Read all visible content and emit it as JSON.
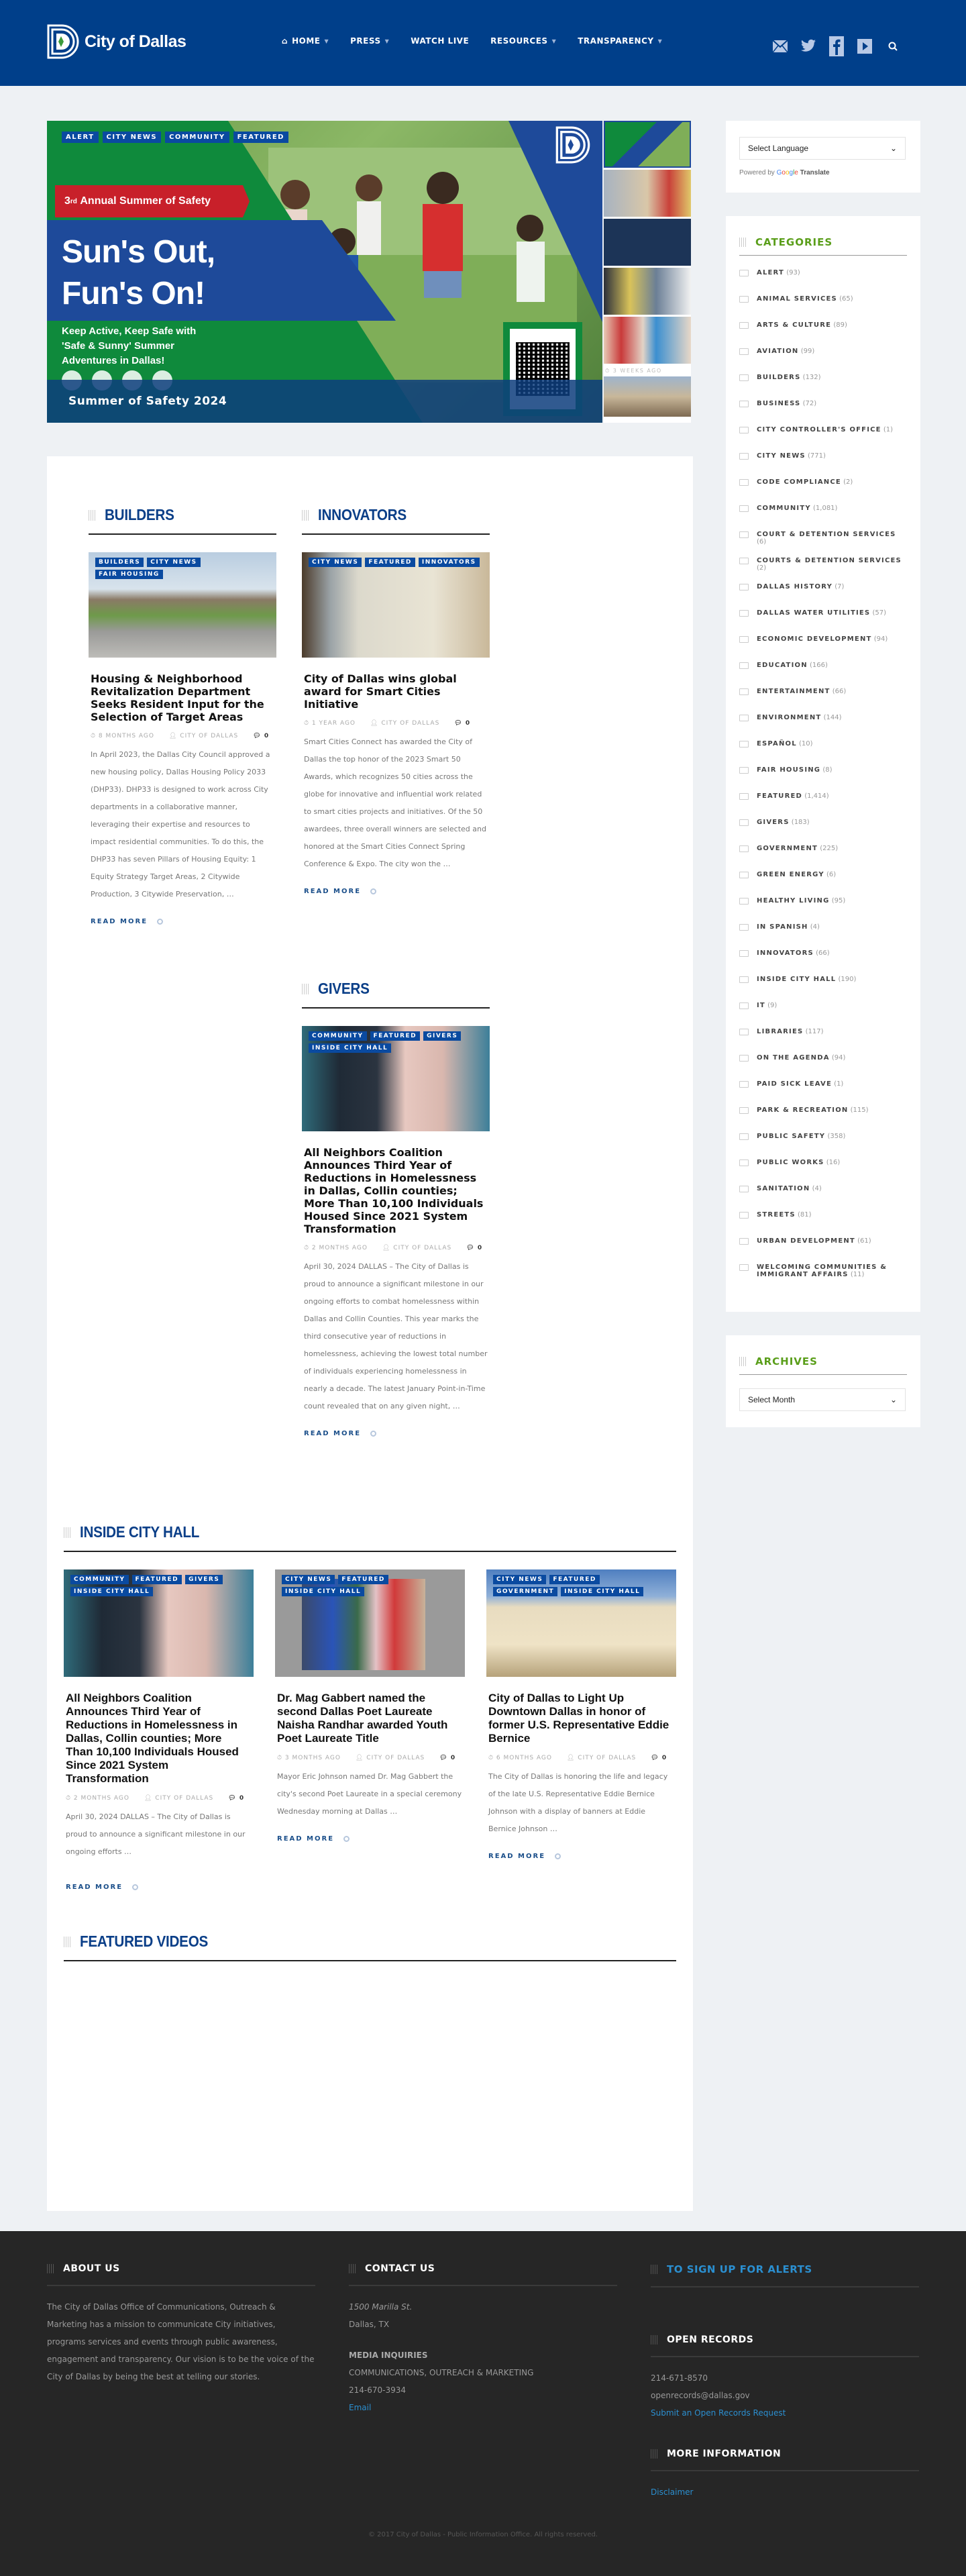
{
  "header": {
    "site_name": "City of Dallas",
    "nav": [
      {
        "label": "HOME",
        "icon": "home-icon",
        "has_dropdown": true
      },
      {
        "label": "PRESS",
        "has_dropdown": true
      },
      {
        "label": "WATCH LIVE",
        "has_dropdown": false
      },
      {
        "label": "RESOURCES",
        "has_dropdown": true
      },
      {
        "label": "TRANSPARENCY",
        "has_dropdown": true
      }
    ],
    "social": [
      "email-icon",
      "twitter-icon",
      "facebook-icon",
      "youtube-icon",
      "search-icon"
    ],
    "brand_color": "#003f8a"
  },
  "hero": {
    "tags": [
      "ALERT",
      "CITY NEWS",
      "COMMUNITY",
      "FEATURED"
    ],
    "banner_num": "3",
    "banner_sup": "rd",
    "banner_text": "Annual Summer of Safety",
    "headline_1": "Sun's Out,",
    "headline_2": "Fun's On!",
    "subtext": "Keep Active, Keep Safe with 'Safe & Sunny' Summer Adventures in Dallas!",
    "caption": "Summer of Safety 2024",
    "thumbs_meta": "3 WEEKS AGO"
  },
  "translate": {
    "select_label": "Select Language",
    "powered_by": "Powered by",
    "translate_label": "Translate"
  },
  "categories": {
    "title": "CATEGORIES",
    "items": [
      {
        "label": "ALERT",
        "count": "(93)"
      },
      {
        "label": "ANIMAL SERVICES",
        "count": "(65)"
      },
      {
        "label": "ARTS & CULTURE",
        "count": "(89)"
      },
      {
        "label": "AVIATION",
        "count": "(99)"
      },
      {
        "label": "BUILDERS",
        "count": "(132)"
      },
      {
        "label": "BUSINESS",
        "count": "(72)"
      },
      {
        "label": "CITY CONTROLLER'S OFFICE",
        "count": "(1)"
      },
      {
        "label": "CITY NEWS",
        "count": "(771)"
      },
      {
        "label": "CODE COMPLIANCE",
        "count": "(2)"
      },
      {
        "label": "COMMUNITY",
        "count": "(1,081)"
      },
      {
        "label": "COURT & DETENTION SERVICES",
        "count": "(6)"
      },
      {
        "label": "COURTS & DETENTION SERVICES",
        "count": "(2)"
      },
      {
        "label": "DALLAS HISTORY",
        "count": "(7)"
      },
      {
        "label": "DALLAS WATER UTILITIES",
        "count": "(57)"
      },
      {
        "label": "ECONOMIC DEVELOPMENT",
        "count": "(94)"
      },
      {
        "label": "EDUCATION",
        "count": "(166)"
      },
      {
        "label": "ENTERTAINMENT",
        "count": "(66)"
      },
      {
        "label": "ENVIRONMENT",
        "count": "(144)"
      },
      {
        "label": "ESPAÑOL",
        "count": "(10)"
      },
      {
        "label": "FAIR HOUSING",
        "count": "(8)"
      },
      {
        "label": "FEATURED",
        "count": "(1,414)"
      },
      {
        "label": "GIVERS",
        "count": "(183)"
      },
      {
        "label": "GOVERNMENT",
        "count": "(225)"
      },
      {
        "label": "GREEN ENERGY",
        "count": "(6)"
      },
      {
        "label": "HEALTHY LIVING",
        "count": "(95)"
      },
      {
        "label": "IN SPANISH",
        "count": "(4)"
      },
      {
        "label": "INNOVATORS",
        "count": "(66)"
      },
      {
        "label": "INSIDE CITY HALL",
        "count": "(190)"
      },
      {
        "label": "IT",
        "count": "(9)"
      },
      {
        "label": "LIBRARIES",
        "count": "(117)"
      },
      {
        "label": "ON THE AGENDA",
        "count": "(94)"
      },
      {
        "label": "PAID SICK LEAVE",
        "count": "(1)"
      },
      {
        "label": "PARK & RECREATION",
        "count": "(115)"
      },
      {
        "label": "PUBLIC SAFETY",
        "count": "(358)"
      },
      {
        "label": "PUBLIC WORKS",
        "count": "(16)"
      },
      {
        "label": "SANITATION",
        "count": "(4)"
      },
      {
        "label": "STREETS",
        "count": "(81)"
      },
      {
        "label": "URBAN DEVELOPMENT",
        "count": "(61)"
      },
      {
        "label": "WELCOMING COMMUNITIES & IMMIGRANT AFFAIRS",
        "count": "(11)"
      }
    ]
  },
  "archives": {
    "title": "ARCHIVES",
    "select_label": "Select Month"
  },
  "sections": {
    "builders": {
      "title": "BUILDERS",
      "post": {
        "tags": [
          "BUILDERS",
          "CITY NEWS",
          "FAIR HOUSING"
        ],
        "title": "Housing & Neighborhood Revitalization Department Seeks Resident Input for the Selection of Target Areas",
        "time": "8 MONTHS AGO",
        "author": "CITY OF DALLAS",
        "comments": "0",
        "excerpt": "In April 2023, the Dallas City Council approved a new housing policy, Dallas Housing Policy 2033 (DHP33). DHP33 is designed to work across City departments in a collaborative manner, leveraging their expertise and resources to impact residential communities. To do this, the DHP33 has seven Pillars of Housing Equity: 1 Equity Strategy Target Areas, 2 Citywide Production, 3 Citywide Preservation, …",
        "read_more": "READ MORE"
      }
    },
    "innovators": {
      "title": "INNOVATORS",
      "post": {
        "tags": [
          "CITY NEWS",
          "FEATURED",
          "INNOVATORS"
        ],
        "title": "City of Dallas wins global award for Smart Cities Initiative",
        "time": "1 YEAR AGO",
        "author": "CITY OF DALLAS",
        "comments": "0",
        "excerpt": "Smart Cities Connect has awarded the City of Dallas the top honor of the 2023 Smart 50 Awards, which recognizes 50 cities across the globe for innovative and influential work related to smart cities projects and initiatives. Of the 50 awardees, three overall winners are selected and honored at the Smart Cities Connect Spring Conference & Expo. The city won the …",
        "read_more": "READ MORE"
      }
    },
    "givers": {
      "title": "GIVERS",
      "post": {
        "tags": [
          "COMMUNITY",
          "FEATURED",
          "GIVERS",
          "INSIDE CITY HALL"
        ],
        "title": "All Neighbors Coalition Announces Third Year of Reductions in Homelessness in Dallas, Collin counties; More Than 10,100 Individuals Housed Since 2021 System Transformation",
        "time": "2 MONTHS AGO",
        "author": "CITY OF DALLAS",
        "comments": "0",
        "excerpt": "April 30, 2024 DALLAS – The City of Dallas is proud to announce a significant milestone in our ongoing efforts to combat homelessness within Dallas and Collin Counties. This year marks the third consecutive year of reductions in homelessness, achieving the lowest total number of individuals experiencing homelessness in nearly a decade. The latest January Point-in-Time count revealed that on any given night, …",
        "read_more": "READ MORE"
      }
    },
    "inside_city_hall": {
      "title": "INSIDE CITY HALL",
      "posts": [
        {
          "tags": [
            "COMMUNITY",
            "FEATURED",
            "GIVERS",
            "INSIDE CITY HALL"
          ],
          "title": "All Neighbors Coalition Announces Third Year of Reductions in Homelessness in Dallas, Collin counties; More Than 10,100 Individuals Housed Since 2021 System Transformation",
          "time": "2 MONTHS AGO",
          "author": "CITY OF DALLAS",
          "comments": "0",
          "excerpt": "April 30, 2024 DALLAS – The City of Dallas is proud to announce a significant milestone in our ongoing efforts …",
          "read_more": "READ MORE"
        },
        {
          "tags": [
            "CITY NEWS",
            "FEATURED",
            "INSIDE CITY HALL"
          ],
          "title": "Dr. Mag Gabbert named the second Dallas Poet Laureate Naisha Randhar awarded Youth Poet Laureate Title",
          "time": "3 MONTHS AGO",
          "author": "CITY OF DALLAS",
          "comments": "0",
          "excerpt": "Mayor Eric Johnson named Dr. Mag Gabbert the city's second Poet Laureate in a special ceremony Wednesday morning at Dallas …",
          "read_more": "READ MORE"
        },
        {
          "tags": [
            "CITY NEWS",
            "FEATURED",
            "GOVERNMENT",
            "INSIDE CITY HALL"
          ],
          "title": "City of Dallas to Light Up Downtown Dallas in honor of former U.S. Representative Eddie Bernice",
          "time": "6 MONTHS AGO",
          "author": "CITY OF DALLAS",
          "comments": "0",
          "excerpt": "The City of Dallas is honoring the life and legacy of the late U.S. Representative Eddie Bernice Johnson with a display of banners at Eddie Bernice Johnson …",
          "read_more": "READ MORE"
        }
      ]
    },
    "featured_videos": {
      "title": "FEATURED VIDEOS"
    }
  },
  "footer": {
    "about": {
      "title": "ABOUT US",
      "text": "The City of Dallas Office of Communications, Outreach & Marketing has a mission to communicate City initiatives, programs services and events through public awareness, engagement and transparency. Our vision is to be the voice of the City of Dallas by being the best at telling our stories."
    },
    "contact": {
      "title": "CONTACT US",
      "address_1": "1500 Marilla St.",
      "address_2": "Dallas, TX",
      "media_heading": "MEDIA INQUIRIES",
      "media_dept": "COMMUNICATIONS, OUTREACH & MARKETING",
      "phone": "214-670-3934",
      "email_link": "Email"
    },
    "alerts": {
      "title": "TO SIGN UP FOR ALERTS"
    },
    "open_records": {
      "title": "OPEN RECORDS",
      "phone": "214-671-8570",
      "email": "openrecords@dallas.gov",
      "link": "Submit an Open Records Request"
    },
    "more_info": {
      "title": "MORE INFORMATION",
      "link": "Disclaimer"
    },
    "copyright": "© 2017 City of Dallas - Public Information Office. All rights reserved."
  }
}
